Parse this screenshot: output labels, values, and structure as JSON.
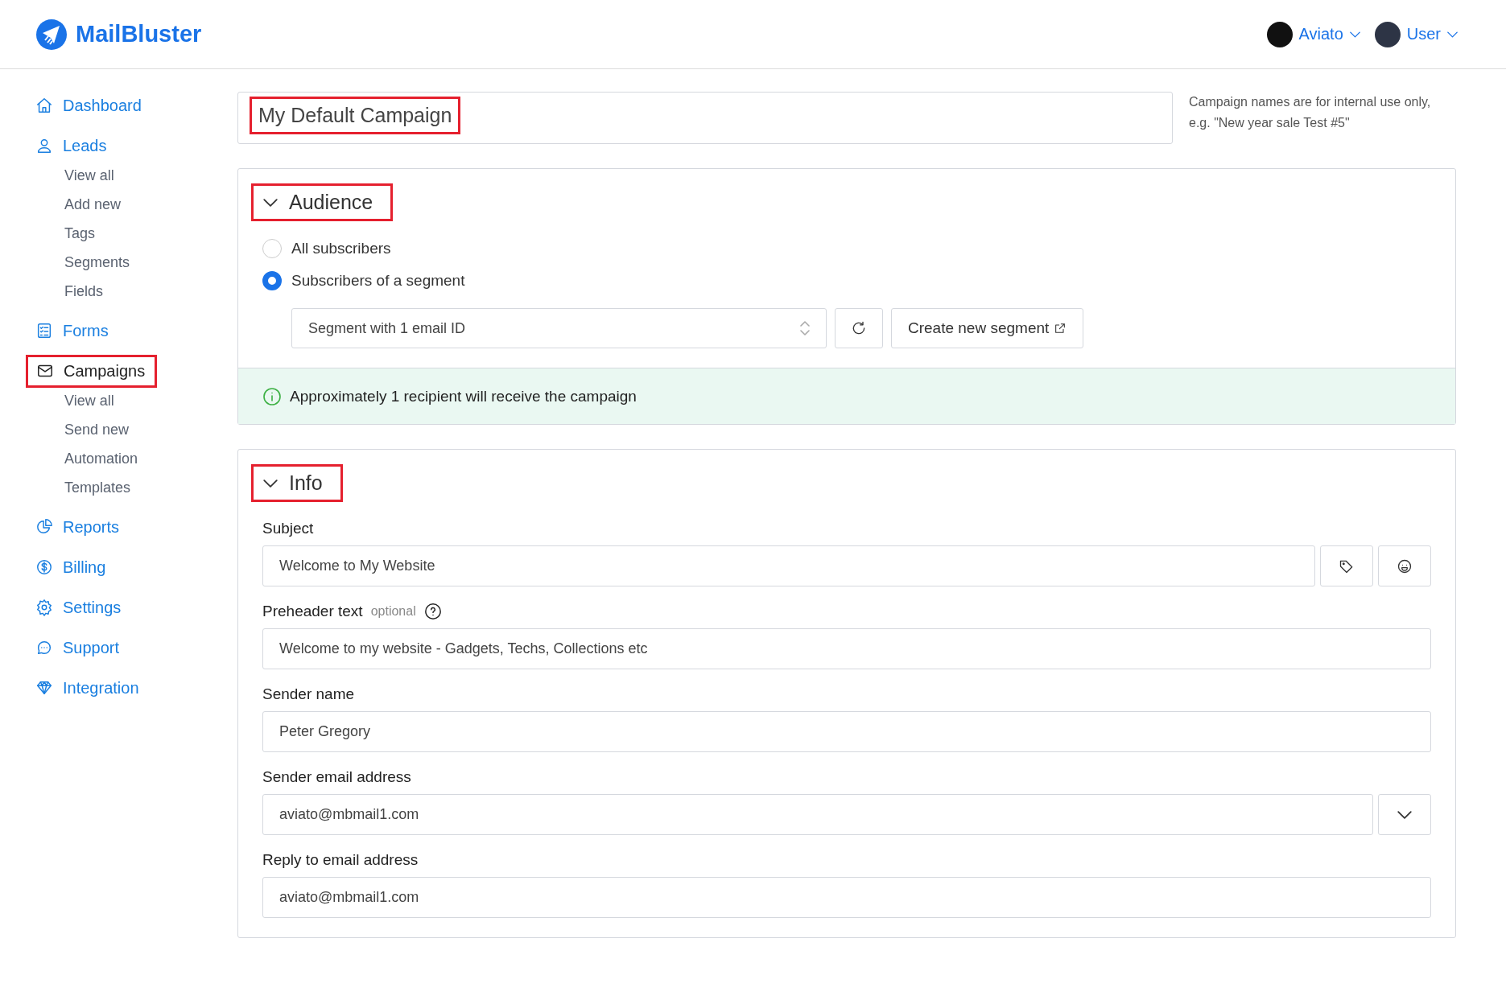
{
  "header": {
    "brand": "MailBluster",
    "account": {
      "label": "Aviato"
    },
    "user": {
      "label": "User"
    }
  },
  "sidebar": {
    "items": [
      {
        "label": "Dashboard",
        "selected": false,
        "highlighted": false
      },
      {
        "label": "Leads",
        "selected": false,
        "highlighted": false,
        "children": [
          {
            "label": "View all"
          },
          {
            "label": "Add new"
          },
          {
            "label": "Tags"
          },
          {
            "label": "Segments"
          },
          {
            "label": "Fields"
          }
        ]
      },
      {
        "label": "Forms",
        "selected": false,
        "highlighted": false
      },
      {
        "label": "Campaigns",
        "selected": true,
        "highlighted": true,
        "children": [
          {
            "label": "View all"
          },
          {
            "label": "Send new"
          },
          {
            "label": "Automation"
          },
          {
            "label": "Templates"
          }
        ]
      },
      {
        "label": "Reports",
        "selected": false,
        "highlighted": false
      },
      {
        "label": "Billing",
        "selected": false,
        "highlighted": false
      },
      {
        "label": "Settings",
        "selected": false,
        "highlighted": false
      },
      {
        "label": "Support",
        "selected": false,
        "highlighted": false
      },
      {
        "label": "Integration",
        "selected": false,
        "highlighted": false
      }
    ]
  },
  "campaign_name": {
    "value": "My Default Campaign",
    "highlighted": true,
    "hint": "Campaign names are for internal use only, e.g. \"New year sale Test #5\""
  },
  "audience": {
    "title": "Audience",
    "expanded": true,
    "highlighted": true,
    "options": [
      {
        "label": "All subscribers",
        "selected": false
      },
      {
        "label": "Subscribers of a segment",
        "selected": true
      }
    ],
    "segment_select": {
      "value": "Segment with 1 email ID"
    },
    "create_button": {
      "label": "Create new segment"
    },
    "notice": "Approximately 1 recipient will receive the campaign"
  },
  "info": {
    "title": "Info",
    "expanded": true,
    "highlighted": true,
    "fields": [
      {
        "label": "Subject",
        "value": "Welcome to My Website",
        "kind": "subject"
      },
      {
        "label": "Preheader text",
        "note": "optional",
        "value": "Welcome to my website - Gadgets, Techs, Collections etc",
        "kind": "help"
      },
      {
        "label": "Sender name",
        "value": "Peter Gregory",
        "kind": "text"
      },
      {
        "label": "Sender email address",
        "value": "aviato@mbmail1.com",
        "kind": "dropdown"
      },
      {
        "label": "Reply to email address",
        "value": "aviato@mbmail1.com",
        "kind": "text"
      }
    ]
  }
}
